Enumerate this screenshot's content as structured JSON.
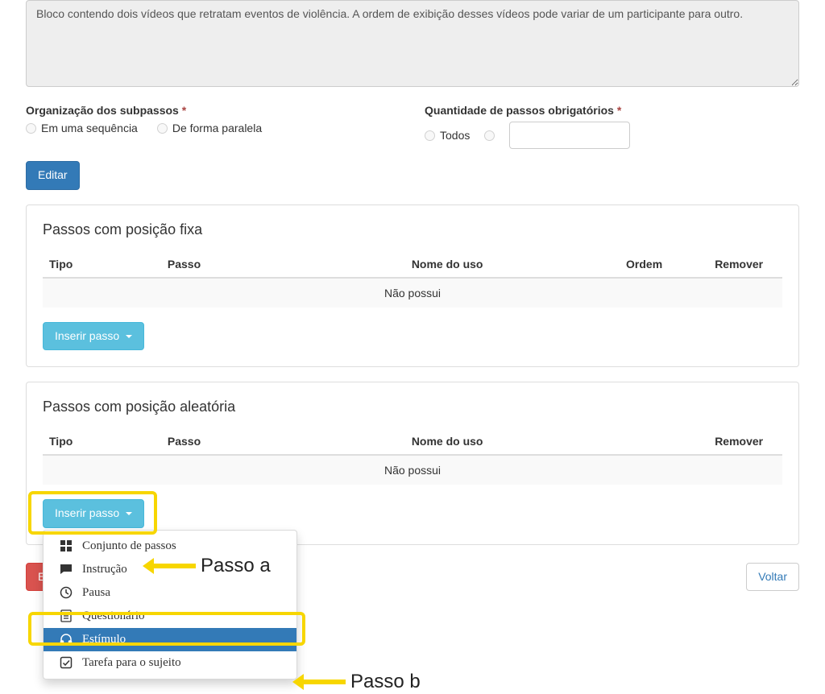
{
  "description_value": "Bloco contendo dois vídeos que retratam eventos de violência. A ordem de exibição desses vídeos pode variar de um participante para outro.",
  "organization": {
    "label": "Organização dos subpassos",
    "options": {
      "seq": "Em uma sequência",
      "par": "De forma paralela"
    }
  },
  "mandatory": {
    "label": "Quantidade de passos obrigatórios",
    "all_label": "Todos"
  },
  "edit_button": "Editar",
  "fixed_panel": {
    "title": "Passos com posição fixa",
    "cols": {
      "tipo": "Tipo",
      "passo": "Passo",
      "uso": "Nome do uso",
      "ordem": "Ordem",
      "remover": "Remover"
    },
    "empty": "Não possui",
    "insert": "Inserir passo"
  },
  "random_panel": {
    "title": "Passos com posição aleatória",
    "cols": {
      "tipo": "Tipo",
      "passo": "Passo",
      "uso": "Nome do uso",
      "remover": "Remover"
    },
    "empty": "Não possui",
    "insert": "Inserir passo"
  },
  "dropdown": {
    "items": {
      "set": "Conjunto de passos",
      "instruction": "Instrução",
      "pause": "Pausa",
      "questionnaire": "Questionário",
      "stimulus": "Estímulo",
      "task": "Tarefa para o sujeito"
    }
  },
  "footer": {
    "delete": "Excluir",
    "back": "Voltar"
  },
  "annotations": {
    "step_a": "Passo a",
    "step_b": "Passo b"
  }
}
